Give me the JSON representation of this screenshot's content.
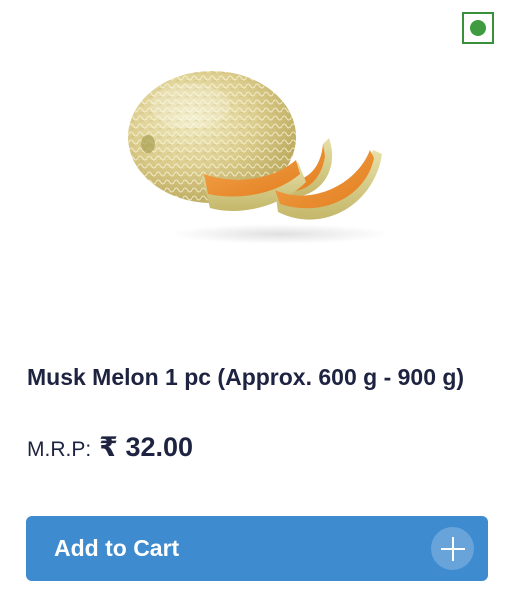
{
  "product": {
    "name": "Musk Melon 1 pc (Approx. 600 g - 900 g)",
    "image_subject": "musk melon",
    "veg_indicator": "veg-mark-icon",
    "veg_color": "#3f9b3f"
  },
  "price": {
    "label": "M.R.P:",
    "value": "₹ 32.00"
  },
  "cart_button": {
    "label": "Add to Cart",
    "icon": "plus-icon",
    "color": "#3e8bd0"
  }
}
